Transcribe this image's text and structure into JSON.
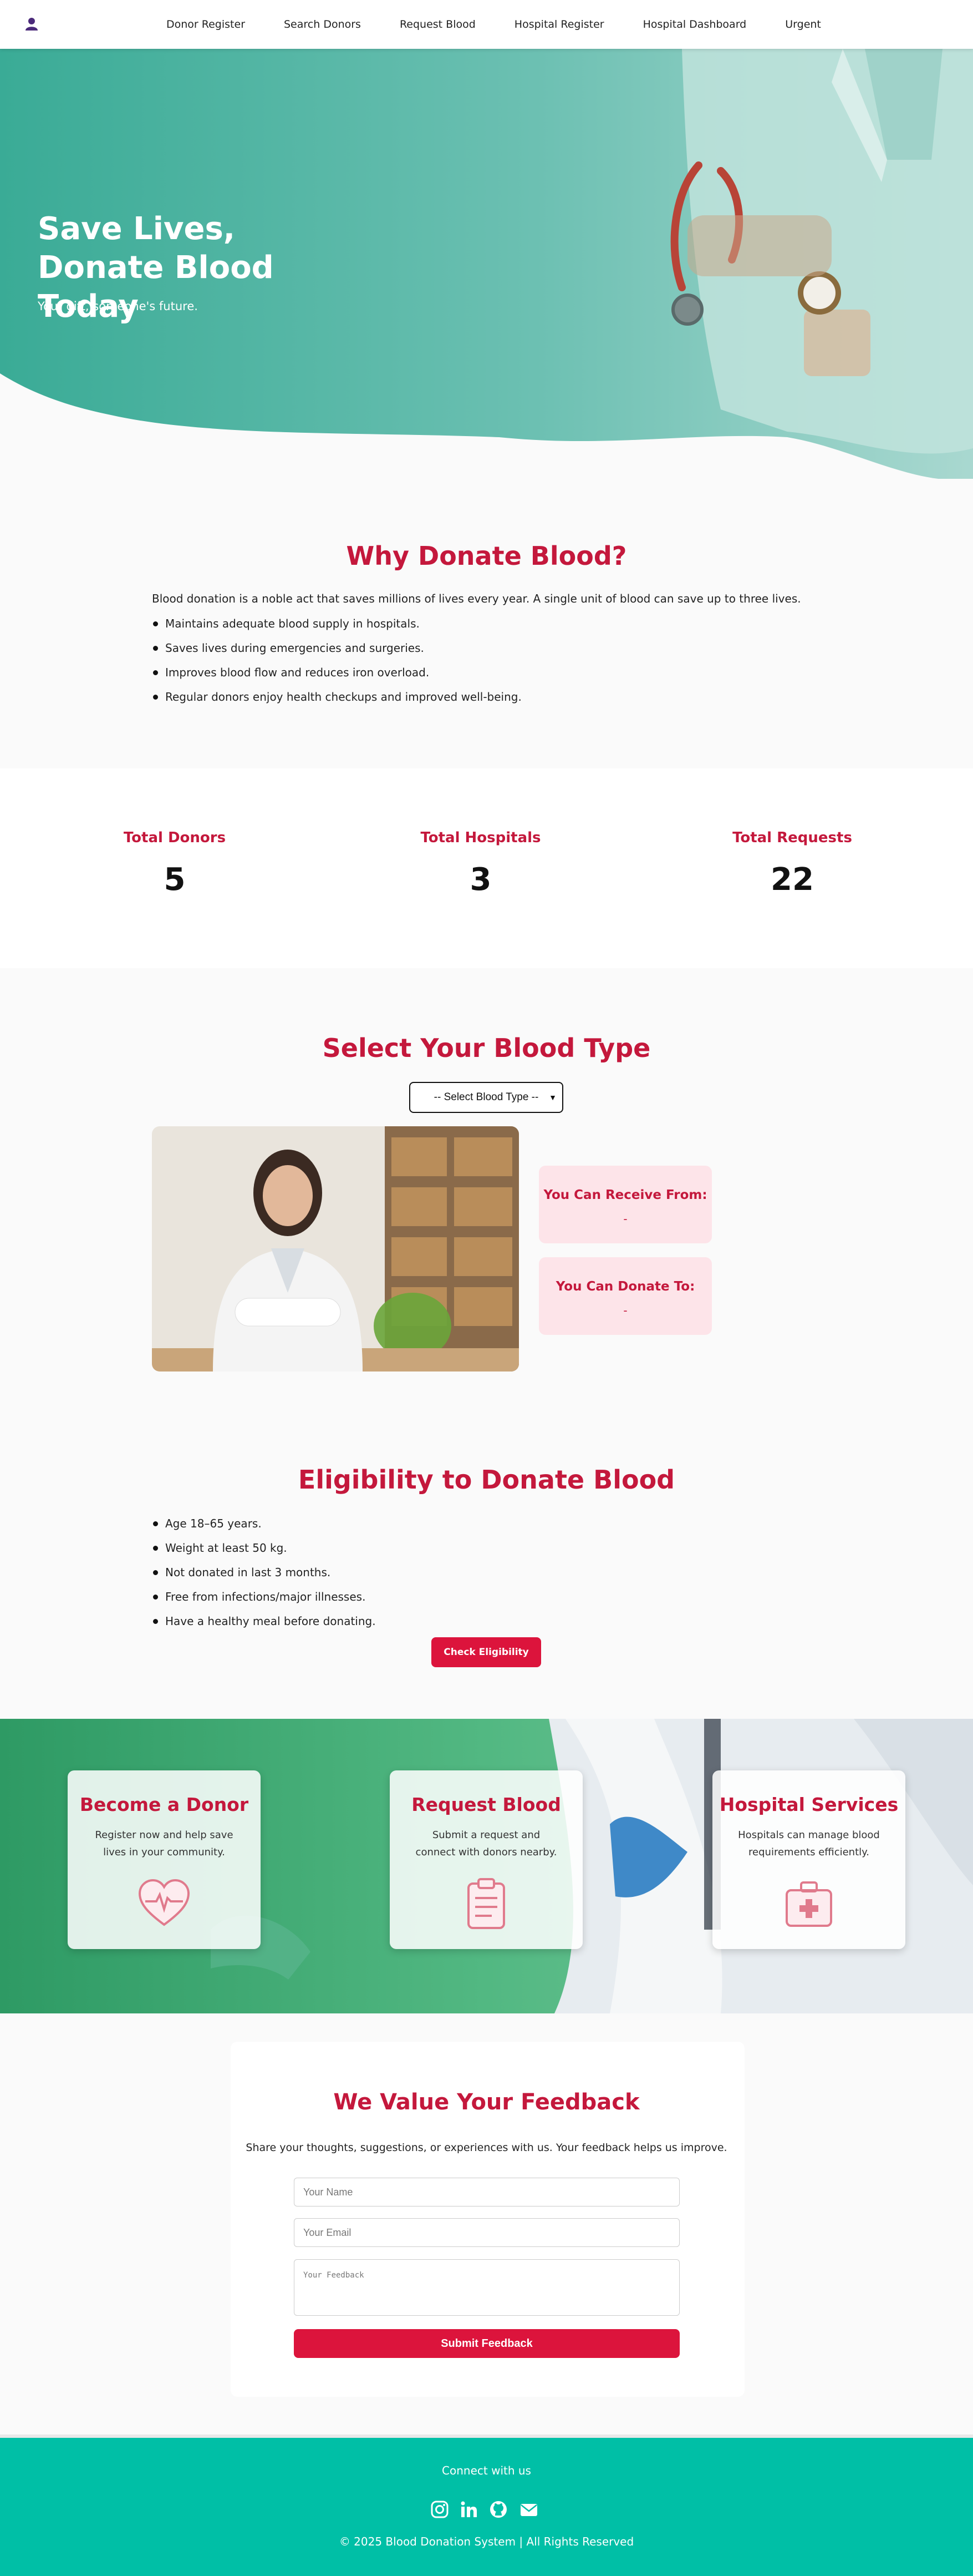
{
  "nav": {
    "links": [
      "Donor Register",
      "Search Donors",
      "Request Blood",
      "Hospital Register",
      "Hospital Dashboard",
      "Urgent"
    ]
  },
  "hero": {
    "title": "Save Lives, Donate Blood Today",
    "subtitle": "Your gift, someone's future."
  },
  "why": {
    "title": "Why Donate Blood?",
    "intro": "Blood donation is a noble act that saves millions of lives every year. A single unit of blood can save up to three lives.",
    "points": [
      "Maintains adequate blood supply in hospitals.",
      "Saves lives during emergencies and surgeries.",
      "Improves blood flow and reduces iron overload.",
      "Regular donors enjoy health checkups and improved well-being."
    ]
  },
  "stats": [
    {
      "label": "Total Donors",
      "value": "5"
    },
    {
      "label": "Total Hospitals",
      "value": "3"
    },
    {
      "label": "Total Requests",
      "value": "22"
    }
  ],
  "blood_type": {
    "title": "Select Your Blood Type",
    "select_value": "-- Select Blood Type --",
    "receive_label": "You Can Receive From:",
    "receive_value": "-",
    "donate_label": "You Can Donate To:",
    "donate_value": "-"
  },
  "eligibility": {
    "title": "Eligibility to Donate Blood",
    "points": [
      "Age 18–65 years.",
      "Weight at least 50 kg.",
      "Not donated in last 3 months.",
      "Free from infections/major illnesses.",
      "Have a healthy meal before donating."
    ],
    "button": "Check Eligibility"
  },
  "services": [
    {
      "title": "Become a Donor",
      "desc": "Register now and help save lives in your community.",
      "icon": "heart-pulse-icon"
    },
    {
      "title": "Request Blood",
      "desc": "Submit a request and connect with donors nearby.",
      "icon": "clipboard-icon"
    },
    {
      "title": "Hospital Services",
      "desc": "Hospitals can manage blood requirements efficiently.",
      "icon": "medical-kit-icon"
    }
  ],
  "feedback": {
    "title": "We Value Your Feedback",
    "intro": "Share your thoughts, suggestions, or experiences with us. Your feedback helps us improve.",
    "name_placeholder": "Your Name",
    "email_placeholder": "Your Email",
    "feedback_placeholder": "Your Feedback",
    "submit": "Submit Feedback"
  },
  "footer": {
    "connect": "Connect with us",
    "social": [
      "instagram-icon",
      "linkedin-icon",
      "github-icon",
      "envelope-icon"
    ],
    "copyright": "© 2025 Blood Donation System | All Rights Reserved"
  },
  "colors": {
    "accent": "#c4183c",
    "button": "#dc143c",
    "hero_teal": "#3aab96",
    "footer_teal": "#00bfa6",
    "compat_bg": "#fde4e9"
  }
}
